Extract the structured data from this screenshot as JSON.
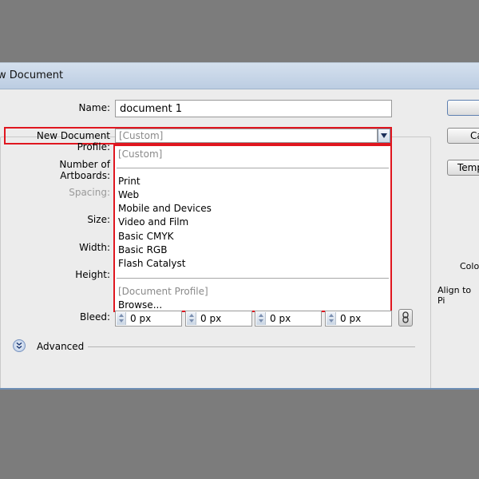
{
  "dialog": {
    "title": "w Document"
  },
  "form": {
    "name_label": "Name:",
    "name_value": "document 1",
    "profile_label": "New Document Profile:",
    "profile_value": "[Custom]",
    "artboards_label": "Number of Artboards:",
    "spacing_label": "Spacing:",
    "size_label": "Size:",
    "width_label": "Width:",
    "height_label": "Height:",
    "bleed_label": "Bleed:",
    "bleed_values": [
      "0 px",
      "0 px",
      "0 px",
      "0 px"
    ],
    "advanced_label": "Advanced"
  },
  "dropdown": {
    "items_top": [
      "[Custom]"
    ],
    "items_main": [
      "Print",
      "Web",
      "Mobile and Devices",
      "Video and Film",
      "Basic CMYK",
      "Basic RGB",
      "Flash Catalyst"
    ],
    "items_bottom": [
      "[Document Profile]",
      "Browse..."
    ]
  },
  "right": {
    "cancel_label": "Ca",
    "templates_label": "Temp",
    "color_label": "Colo",
    "align_label": "Align to Pi"
  },
  "icons": {
    "dropdown_arrow": "triangle-down-icon",
    "advanced": "double-chevron-down-icon",
    "link": "link-chain-icon"
  },
  "colors": {
    "highlight": "#e0161f",
    "titlebar": "#c8d7e8",
    "background": "#7c7c7c"
  }
}
